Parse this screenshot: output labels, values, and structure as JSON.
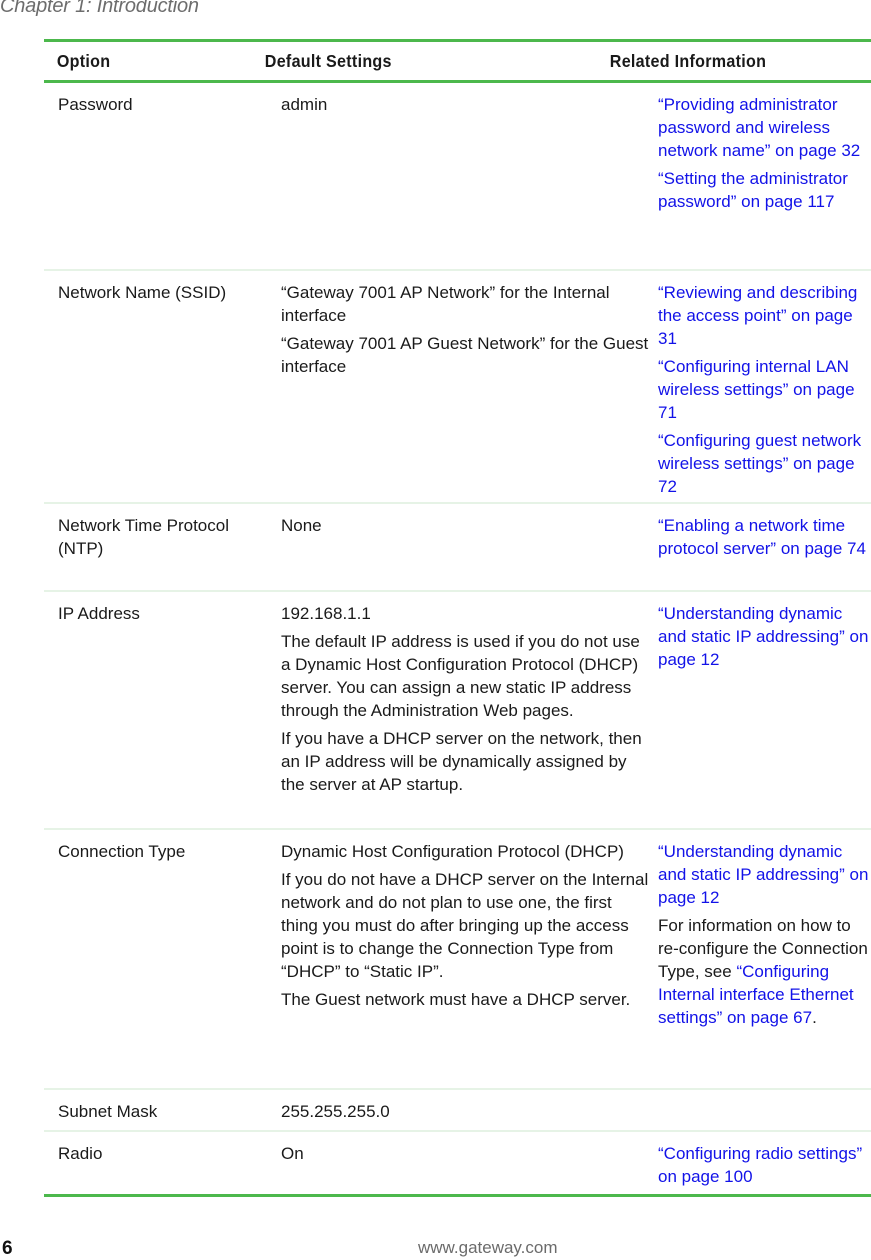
{
  "header": {
    "chapter_title": "Chapter 1: Introduction"
  },
  "table": {
    "columns": [
      "Option",
      "Default Settings",
      "Related Information"
    ],
    "rows": [
      {
        "option": "Password",
        "defaults": [
          "admin"
        ],
        "related": [
          [
            {
              "text": "“Providing administrator password and wireless network name” on page 32",
              "link": true
            }
          ],
          [
            {
              "text": "“Setting the administrator password” on page 117",
              "link": true
            }
          ]
        ]
      },
      {
        "option": "Network Name (SSID)",
        "defaults": [
          "“Gateway 7001 AP Network” for the Internal interface",
          "“Gateway 7001 AP Guest Network” for the Guest interface"
        ],
        "related": [
          [
            {
              "text": "“Reviewing and describing the access point” on page 31",
              "link": true
            }
          ],
          [
            {
              "text": "“Configuring internal LAN wireless settings” on page 71",
              "link": true
            }
          ],
          [
            {
              "text": "“Configuring guest network wireless settings” on page 72",
              "link": true
            }
          ]
        ]
      },
      {
        "option": "Network Time Protocol (NTP)",
        "defaults": [
          "None"
        ],
        "related": [
          [
            {
              "text": "“Enabling a network time protocol server” on page 74",
              "link": true
            }
          ]
        ]
      },
      {
        "option": "IP Address",
        "defaults": [
          "192.168.1.1",
          "The default IP address is used if you do not use a Dynamic Host Configuration Protocol (DHCP) server. You can assign a new static IP address through the Administration Web pages.",
          "If you have a DHCP server on the network, then an IP address will be dynamically assigned by the server at AP startup."
        ],
        "related": [
          [
            {
              "text": "“Understanding dynamic and static IP addressing” on page 12",
              "link": true
            }
          ]
        ]
      },
      {
        "option": "Connection Type",
        "defaults": [
          "Dynamic Host Configuration Protocol (DHCP)",
          "If you do not have a DHCP server on the Internal network and do not plan to use one, the first thing you must do after bringing up the access point is to change the Connection Type from “DHCP” to “Static IP”.",
          "The Guest network must have a DHCP server."
        ],
        "related": [
          [
            {
              "text": "“Understanding dynamic and static IP addressing” on page 12",
              "link": true
            }
          ],
          [
            {
              "text": "For information on how to re-configure the Connection Type, see ",
              "link": false
            },
            {
              "text": "“Configuring Internal interface Ethernet settings” on page 67",
              "link": true
            },
            {
              "text": ".",
              "link": false
            }
          ]
        ]
      },
      {
        "option": "Subnet Mask",
        "defaults": [
          "255.255.255.0"
        ],
        "related": []
      },
      {
        "option": "Radio",
        "defaults": [
          "On"
        ],
        "related": [
          [
            {
              "text": "“Configuring radio settings” on page 100",
              "link": true
            }
          ]
        ]
      }
    ]
  },
  "footer": {
    "page_number": "6",
    "url": "www.gateway.com"
  },
  "colors": {
    "rule": "#4cb84c",
    "row_divider": "#e6f3e6",
    "link": "#1212e8"
  }
}
